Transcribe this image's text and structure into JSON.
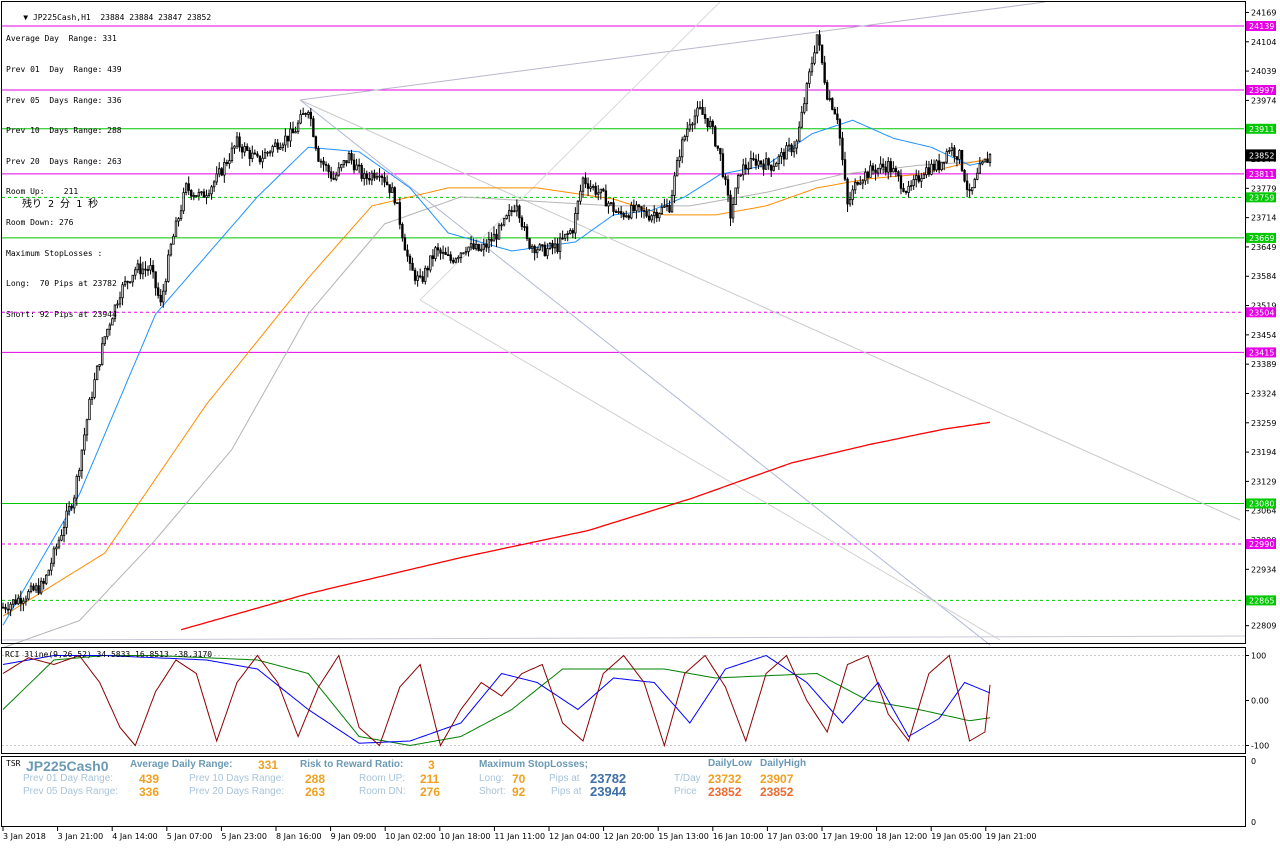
{
  "header": {
    "symbol_line": "JP225Cash,H1  23884 23884 23847 23852",
    "lines": [
      "Average Day  Range: 331",
      "Prev 01  Day  Range: 439",
      "Prev 05  Days Range: 336",
      "Prev 10  Days Range: 288",
      "Prev 20  Days Range: 263",
      "Room Up:    211",
      "Room Down: 276",
      "Maximum StopLosses :",
      "Long:  70 Pips at 23782",
      "Short: 92 Pips at 23944"
    ],
    "countdown": "残り 2 分 1 秒"
  },
  "rci_label": "RCI 3line(9,26,52) 34.5833 16.8513 -38.3170",
  "tsr": {
    "label": "TSR",
    "symbol": "JP225Cash0",
    "avg_range_label": "Average Daily Range:",
    "avg_range_value": "331",
    "rr_label": "Risk to Reward Ratio:",
    "rr_value": "3",
    "max_sl_label": "Maximum StopLosses;",
    "daily_low_label": "DailyLow",
    "daily_high_label": "DailyHigh",
    "prev01_label": "Prev 01 Day Range:",
    "prev01_value": "439",
    "prev05_label": "Prev 05 Days Range:",
    "prev05_value": "336",
    "prev10_label": "Prev 10 Days Range:",
    "prev10_value": "288",
    "prev20_label": "Prev 20 Days Range:",
    "prev20_value": "263",
    "room_up_label": "Room UP:",
    "room_up_value": "211",
    "room_dn_label": "Room DN:",
    "room_dn_value": "276",
    "long_label": "Long:",
    "long_value": "70",
    "short_label": "Short:",
    "short_value": "92",
    "pips_at_label": "Pips at",
    "long_price": "23782",
    "short_price": "23944",
    "tday_label": "T/Day",
    "tday_low": "23732",
    "tday_high": "23907",
    "price_label": "Price",
    "price_low": "23852",
    "price_high": "23852"
  },
  "colors": {
    "bull": "#ffffff",
    "bear": "#000000",
    "ma_fast": "#1e90ff",
    "ma_mid": "#ff8c00",
    "ma_slow": "#ff0000",
    "ma_grey": "#b4b4b4",
    "rci_short": "#8b0000",
    "rci_mid": "#0000ff",
    "rci_long": "#008000",
    "level_green": "#00c800",
    "level_magenta": "#e600e6",
    "price_tag": "#000000"
  },
  "chart_data": {
    "type": "candlestick",
    "title": "JP225Cash,H1",
    "ylim": [
      22775,
      24190
    ],
    "y_ticks": [
      24169,
      24104,
      24039,
      23974,
      23909,
      23844,
      23779,
      23714,
      23649,
      23584,
      23519,
      23454,
      23389,
      23324,
      23259,
      23194,
      23129,
      23064,
      22999,
      22934,
      22869,
      22809
    ],
    "x_ticks": [
      "3 Jan 2018",
      "3 Jan 21:00",
      "4 Jan 14:00",
      "5 Jan 07:00",
      "5 Jan 23:00",
      "8 Jan 16:00",
      "9 Jan 09:00",
      "10 Jan 02:00",
      "10 Jan 18:00",
      "11 Jan 11:00",
      "12 Jan 04:00",
      "12 Jan 20:00",
      "15 Jan 13:00",
      "16 Jan 10:00",
      "17 Jan 03:00",
      "17 Jan 19:00",
      "18 Jan 12:00",
      "19 Jan 05:00",
      "19 Jan 21:00"
    ],
    "price_levels": [
      {
        "value": 24139,
        "label": "24139",
        "color": "#e600e6",
        "style": "solid"
      },
      {
        "value": 23997,
        "label": "23997",
        "color": "#e600e6",
        "style": "solid"
      },
      {
        "value": 23911,
        "label": "23911",
        "color": "#00c800",
        "style": "solid"
      },
      {
        "value": 23811,
        "label": "23811",
        "color": "#e600e6",
        "style": "solid"
      },
      {
        "value": 23759,
        "label": "23759",
        "color": "#00c800",
        "style": "dashed"
      },
      {
        "value": 23669,
        "label": "23669",
        "color": "#00c800",
        "style": "solid"
      },
      {
        "value": 23504,
        "label": "23504",
        "color": "#e600e6",
        "style": "dashed"
      },
      {
        "value": 23415,
        "label": "23415",
        "color": "#e600e6",
        "style": "solid"
      },
      {
        "value": 23080,
        "label": "23080",
        "color": "#00c800",
        "style": "solid"
      },
      {
        "value": 22990,
        "label": "22990",
        "color": "#e600e6",
        "style": "dashed"
      },
      {
        "value": 22865,
        "label": "22865",
        "color": "#00c800",
        "style": "dashed"
      }
    ],
    "current_price": {
      "value": 23852,
      "label": "23852"
    },
    "close_anchors": [
      [
        0,
        22850
      ],
      [
        10,
        22880
      ],
      [
        16,
        22900
      ],
      [
        22,
        23000
      ],
      [
        28,
        23100
      ],
      [
        34,
        23300
      ],
      [
        40,
        23450
      ],
      [
        46,
        23550
      ],
      [
        52,
        23600
      ],
      [
        58,
        23600
      ],
      [
        62,
        23520
      ],
      [
        66,
        23650
      ],
      [
        72,
        23780
      ],
      [
        78,
        23760
      ],
      [
        84,
        23800
      ],
      [
        92,
        23880
      ],
      [
        100,
        23840
      ],
      [
        108,
        23880
      ],
      [
        114,
        23900
      ],
      [
        120,
        23960
      ],
      [
        124,
        23850
      ],
      [
        130,
        23800
      ],
      [
        136,
        23850
      ],
      [
        142,
        23800
      ],
      [
        148,
        23820
      ],
      [
        154,
        23760
      ],
      [
        160,
        23600
      ],
      [
        164,
        23570
      ],
      [
        170,
        23640
      ],
      [
        176,
        23620
      ],
      [
        182,
        23650
      ],
      [
        188,
        23640
      ],
      [
        196,
        23690
      ],
      [
        202,
        23750
      ],
      [
        206,
        23660
      ],
      [
        212,
        23640
      ],
      [
        218,
        23650
      ],
      [
        224,
        23690
      ],
      [
        228,
        23800
      ],
      [
        232,
        23780
      ],
      [
        236,
        23760
      ],
      [
        242,
        23720
      ],
      [
        248,
        23730
      ],
      [
        254,
        23720
      ],
      [
        262,
        23740
      ],
      [
        266,
        23860
      ],
      [
        270,
        23930
      ],
      [
        274,
        23950
      ],
      [
        278,
        23920
      ],
      [
        282,
        23850
      ],
      [
        286,
        23720
      ],
      [
        290,
        23820
      ],
      [
        296,
        23840
      ],
      [
        302,
        23830
      ],
      [
        308,
        23860
      ],
      [
        312,
        23880
      ],
      [
        316,
        24000
      ],
      [
        320,
        24120
      ],
      [
        324,
        23990
      ],
      [
        328,
        23940
      ],
      [
        332,
        23740
      ],
      [
        336,
        23800
      ],
      [
        342,
        23820
      ],
      [
        348,
        23830
      ],
      [
        352,
        23800
      ],
      [
        356,
        23770
      ],
      [
        362,
        23820
      ],
      [
        368,
        23830
      ],
      [
        372,
        23870
      ],
      [
        376,
        23850
      ],
      [
        380,
        23760
      ],
      [
        384,
        23820
      ],
      [
        388,
        23852
      ]
    ],
    "ma_fast_anchors": [
      [
        0,
        22810
      ],
      [
        30,
        23100
      ],
      [
        60,
        23500
      ],
      [
        100,
        23760
      ],
      [
        120,
        23870
      ],
      [
        140,
        23860
      ],
      [
        160,
        23780
      ],
      [
        175,
        23680
      ],
      [
        200,
        23640
      ],
      [
        225,
        23660
      ],
      [
        240,
        23720
      ],
      [
        255,
        23730
      ],
      [
        268,
        23760
      ],
      [
        282,
        23810
      ],
      [
        300,
        23830
      ],
      [
        318,
        23900
      ],
      [
        334,
        23930
      ],
      [
        350,
        23890
      ],
      [
        365,
        23870
      ],
      [
        380,
        23830
      ],
      [
        388,
        23840
      ]
    ],
    "ma_mid_anchors": [
      [
        0,
        22830
      ],
      [
        40,
        22970
      ],
      [
        80,
        23300
      ],
      [
        120,
        23580
      ],
      [
        145,
        23740
      ],
      [
        175,
        23780
      ],
      [
        210,
        23780
      ],
      [
        240,
        23755
      ],
      [
        260,
        23720
      ],
      [
        280,
        23720
      ],
      [
        300,
        23740
      ],
      [
        320,
        23780
      ],
      [
        340,
        23800
      ],
      [
        360,
        23810
      ],
      [
        375,
        23830
      ],
      [
        388,
        23845
      ]
    ],
    "ma_slow_anchors": [
      [
        70,
        22800
      ],
      [
        120,
        22880
      ],
      [
        180,
        22960
      ],
      [
        230,
        23020
      ],
      [
        270,
        23090
      ],
      [
        310,
        23170
      ],
      [
        340,
        23210
      ],
      [
        370,
        23245
      ],
      [
        388,
        23260
      ]
    ],
    "ma_grey_anchors": [
      [
        0,
        22760
      ],
      [
        30,
        22820
      ],
      [
        60,
        23000
      ],
      [
        90,
        23200
      ],
      [
        120,
        23500
      ],
      [
        150,
        23700
      ],
      [
        180,
        23760
      ],
      [
        210,
        23750
      ],
      [
        240,
        23740
      ],
      [
        270,
        23740
      ],
      [
        300,
        23770
      ],
      [
        330,
        23810
      ],
      [
        360,
        23830
      ],
      [
        388,
        23840
      ]
    ],
    "rci": {
      "ylim": [
        -110,
        110
      ],
      "y_ticks": [
        100,
        0.0,
        -100
      ],
      "short_anchors": [
        [
          0,
          60
        ],
        [
          10,
          95
        ],
        [
          20,
          80
        ],
        [
          30,
          100
        ],
        [
          38,
          40
        ],
        [
          46,
          -60
        ],
        [
          52,
          -100
        ],
        [
          60,
          20
        ],
        [
          68,
          90
        ],
        [
          76,
          60
        ],
        [
          84,
          -90
        ],
        [
          92,
          40
        ],
        [
          100,
          100
        ],
        [
          108,
          40
        ],
        [
          116,
          -80
        ],
        [
          124,
          30
        ],
        [
          132,
          100
        ],
        [
          140,
          -60
        ],
        [
          148,
          -100
        ],
        [
          156,
          30
        ],
        [
          164,
          80
        ],
        [
          172,
          -100
        ],
        [
          180,
          -20
        ],
        [
          188,
          40
        ],
        [
          196,
          10
        ],
        [
          204,
          60
        ],
        [
          212,
          80
        ],
        [
          220,
          -50
        ],
        [
          228,
          -90
        ],
        [
          236,
          60
        ],
        [
          244,
          100
        ],
        [
          252,
          40
        ],
        [
          260,
          -100
        ],
        [
          268,
          60
        ],
        [
          276,
          100
        ],
        [
          284,
          30
        ],
        [
          292,
          -90
        ],
        [
          300,
          60
        ],
        [
          308,
          100
        ],
        [
          316,
          0
        ],
        [
          324,
          -70
        ],
        [
          332,
          80
        ],
        [
          340,
          100
        ],
        [
          348,
          -30
        ],
        [
          356,
          -90
        ],
        [
          364,
          60
        ],
        [
          372,
          100
        ],
        [
          380,
          -90
        ],
        [
          386,
          -70
        ],
        [
          388,
          34.58
        ]
      ],
      "mid_anchors": [
        [
          0,
          80
        ],
        [
          20,
          100
        ],
        [
          40,
          100
        ],
        [
          60,
          95
        ],
        [
          80,
          90
        ],
        [
          100,
          70
        ],
        [
          120,
          -20
        ],
        [
          140,
          -95
        ],
        [
          160,
          -90
        ],
        [
          180,
          -50
        ],
        [
          196,
          60
        ],
        [
          210,
          40
        ],
        [
          226,
          -20
        ],
        [
          240,
          50
        ],
        [
          256,
          40
        ],
        [
          270,
          -50
        ],
        [
          284,
          70
        ],
        [
          300,
          100
        ],
        [
          316,
          40
        ],
        [
          330,
          -50
        ],
        [
          344,
          40
        ],
        [
          356,
          -80
        ],
        [
          368,
          -40
        ],
        [
          378,
          40
        ],
        [
          388,
          16.85
        ]
      ],
      "long_anchors": [
        [
          0,
          -20
        ],
        [
          20,
          90
        ],
        [
          40,
          100
        ],
        [
          60,
          100
        ],
        [
          80,
          95
        ],
        [
          100,
          90
        ],
        [
          120,
          60
        ],
        [
          140,
          -80
        ],
        [
          160,
          -100
        ],
        [
          180,
          -80
        ],
        [
          200,
          -20
        ],
        [
          220,
          70
        ],
        [
          240,
          70
        ],
        [
          260,
          70
        ],
        [
          280,
          50
        ],
        [
          300,
          55
        ],
        [
          320,
          60
        ],
        [
          340,
          0
        ],
        [
          360,
          -20
        ],
        [
          380,
          -45
        ],
        [
          388,
          -38.32
        ]
      ]
    }
  }
}
